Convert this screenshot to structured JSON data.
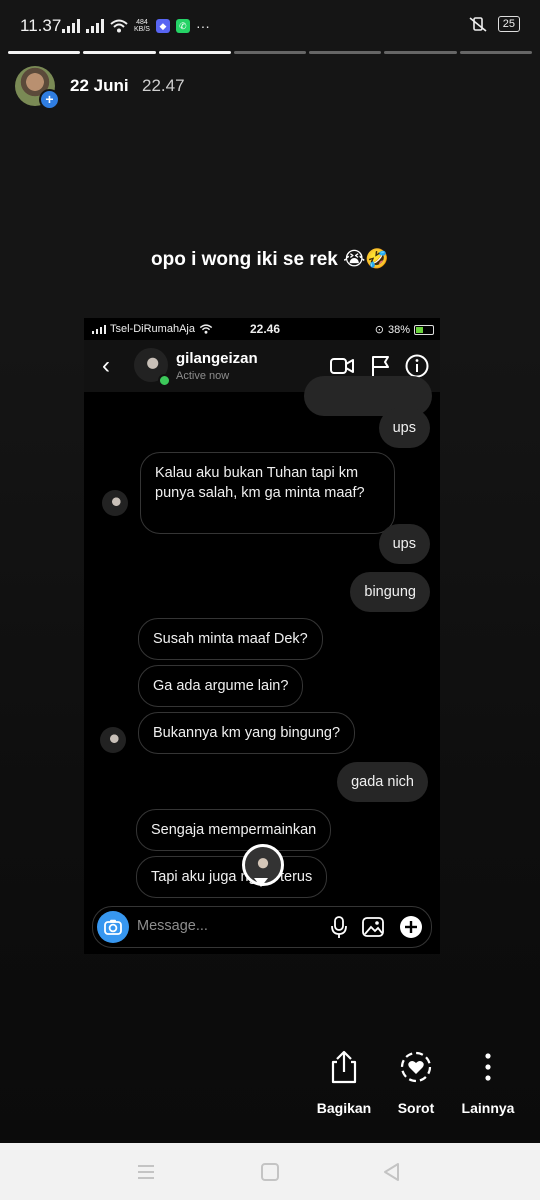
{
  "status_bar": {
    "time": "11.37",
    "net_speed": "484",
    "net_unit": "KB/S",
    "battery": "25",
    "more": "···"
  },
  "story": {
    "date": "22 Juni",
    "time": "22.47",
    "caption": "opo i wong iki se rek 😭🤣",
    "segments_total": 7,
    "segments_done": 3
  },
  "screenshot": {
    "status": {
      "carrier": "Tsel-DiRumahAja",
      "time": "22.46",
      "battery": "38%"
    },
    "header": {
      "username": "gilangeizan",
      "status": "Active now"
    },
    "messages": [
      {
        "from": "me",
        "text": "ups"
      },
      {
        "from": "them",
        "text": "Kalau aku bukan Tuhan tapi km punya salah, km ga minta maaf?"
      },
      {
        "from": "me",
        "text": "ups"
      },
      {
        "from": "me",
        "text": "bingung"
      },
      {
        "from": "them",
        "text": "Susah minta maaf Dek?"
      },
      {
        "from": "them",
        "text": "Ga ada argume lain?"
      },
      {
        "from": "them",
        "text": "Bukannya km yang bingung?"
      },
      {
        "from": "me",
        "text": "gada nich"
      },
      {
        "from": "them",
        "text": "Sengaja mempermainkan"
      },
      {
        "from": "them",
        "text": "Tapi aku juga ngeni terus"
      }
    ],
    "composer_placeholder": "Message..."
  },
  "actions": [
    {
      "label": "Bagikan",
      "icon": "share-icon"
    },
    {
      "label": "Sorot",
      "icon": "highlight-heart-icon"
    },
    {
      "label": "Lainnya",
      "icon": "more-vertical-icon"
    }
  ],
  "colors": {
    "accent": "#3797f0",
    "online": "#3cc85a",
    "background": "#151515"
  }
}
